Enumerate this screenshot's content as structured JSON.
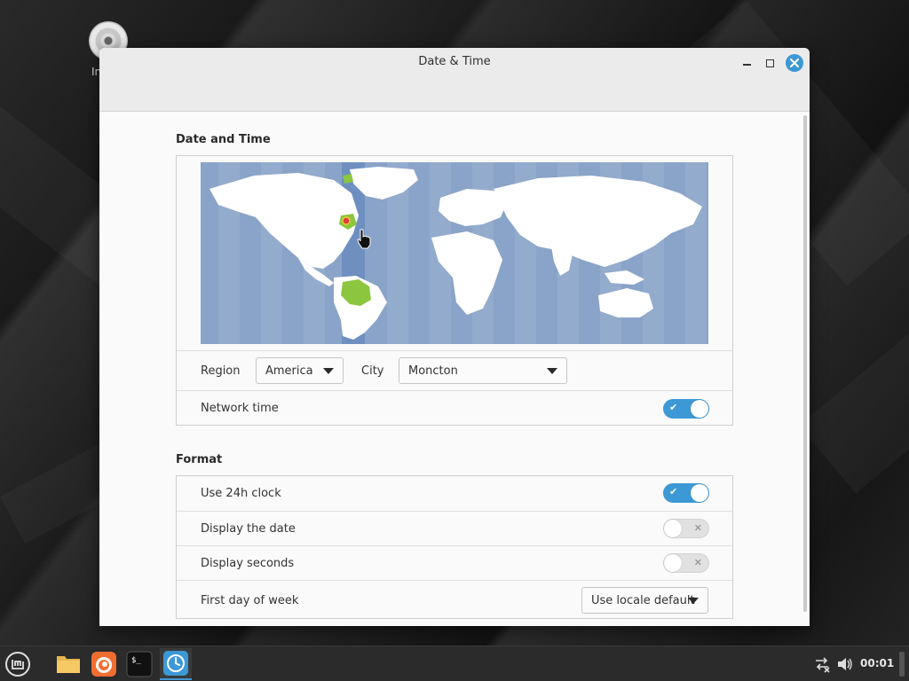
{
  "desktop": {
    "icon_label": "In"
  },
  "window": {
    "title": "Date & Time",
    "controls": {
      "minimize": "minimize-icon",
      "maximize": "maximize-icon",
      "close": "close-icon"
    }
  },
  "date_time_section": {
    "title": "Date and Time",
    "region": {
      "label": "Region",
      "value": "America"
    },
    "city": {
      "label": "City",
      "value": "Moncton"
    },
    "network_time": {
      "label": "Network time",
      "enabled": true
    }
  },
  "format_section": {
    "title": "Format",
    "use_24h": {
      "label": "Use 24h clock",
      "enabled": true
    },
    "display_date": {
      "label": "Display the date",
      "enabled": false
    },
    "display_seconds": {
      "label": "Display seconds",
      "enabled": false
    },
    "first_day": {
      "label": "First day of week",
      "value": "Use locale default"
    }
  },
  "taskbar": {
    "apps": [
      "menu-icon",
      "files-icon",
      "firefox-icon",
      "terminal-icon",
      "clock-icon"
    ],
    "clock": "00:01"
  },
  "colors": {
    "accent": "#3d98d6",
    "map_ocean": "#8aa3c8",
    "map_land": "#ffffff",
    "map_highlight": "#8cc63f"
  }
}
